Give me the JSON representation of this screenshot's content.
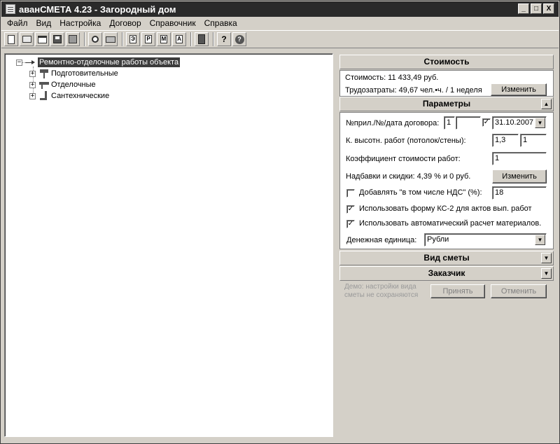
{
  "window": {
    "title": "аванСМЕТА 4.23 - Загородный дом",
    "buttons": [
      "_",
      "□",
      "X"
    ]
  },
  "menu": [
    "Файл",
    "Вид",
    "Настройка",
    "Договор",
    "Справочник",
    "Справка"
  ],
  "toolbar": {
    "icons": [
      "new-doc-icon",
      "open-folder-icon",
      "window-icon",
      "save-icon",
      "export-icon",
      "preview-icon",
      "print-icon",
      "e-icon",
      "p-icon",
      "m-icon",
      "a-icon",
      "book-icon",
      "help-icon",
      "about-icon"
    ],
    "labels": {
      "e": "Э",
      "p": "Р",
      "m": "М",
      "a": "А",
      "q": "?",
      "about": "?"
    }
  },
  "tree": {
    "root": "Ремонтно-отделочные работы объекта",
    "children": [
      "Подготовительные",
      "Отделочные",
      "Сантехнические"
    ],
    "collapse_glyph": "−",
    "expand_glyph": "+"
  },
  "cost": {
    "header": "Стоимость",
    "cost_line": "Стоимость: 11 433,49 руб.",
    "labor_line": "Трудозатраты: 49,67 чел.•ч. / 1 неделя",
    "change_button": "Изменить"
  },
  "params": {
    "header": "Параметры",
    "toggle": "▲",
    "contract_label": "№прил./№/дата договора:",
    "contract_appendix": "1",
    "contract_number": "",
    "contract_date": "31.10.2007",
    "height_label": "К. высотн. работ (потолок/стены):",
    "height_ceiling": "1,3",
    "height_walls": "1",
    "cost_coef_label": "Коэффициент стоимости работ:",
    "cost_coef": "1",
    "markups_label": "Надбавки и скидки: 4,39 % и 0 руб.",
    "markups_button": "Изменить",
    "vat_label": "Добавлять \"в том числе НДС\" (%):",
    "vat_checked": false,
    "vat_value": "18",
    "ks2_label": "Использовать форму КС-2 для актов вып. работ",
    "ks2_checked": true,
    "auto_label": "Использовать автоматический расчет материалов.",
    "auto_checked": true,
    "currency_label": "Денежная единица:",
    "currency_value": "Рубли",
    "check_glyph": "✓",
    "dropdown_glyph": "▼"
  },
  "estimate_type": {
    "header": "Вид сметы",
    "toggle": "▼"
  },
  "customer": {
    "header": "Заказчик",
    "toggle": "▼"
  },
  "footer": {
    "demo_note_1": "Демо: настройки вида",
    "demo_note_2": "сметы не сохраняются",
    "accept_button": "Принять",
    "cancel_button": "Отменить"
  }
}
